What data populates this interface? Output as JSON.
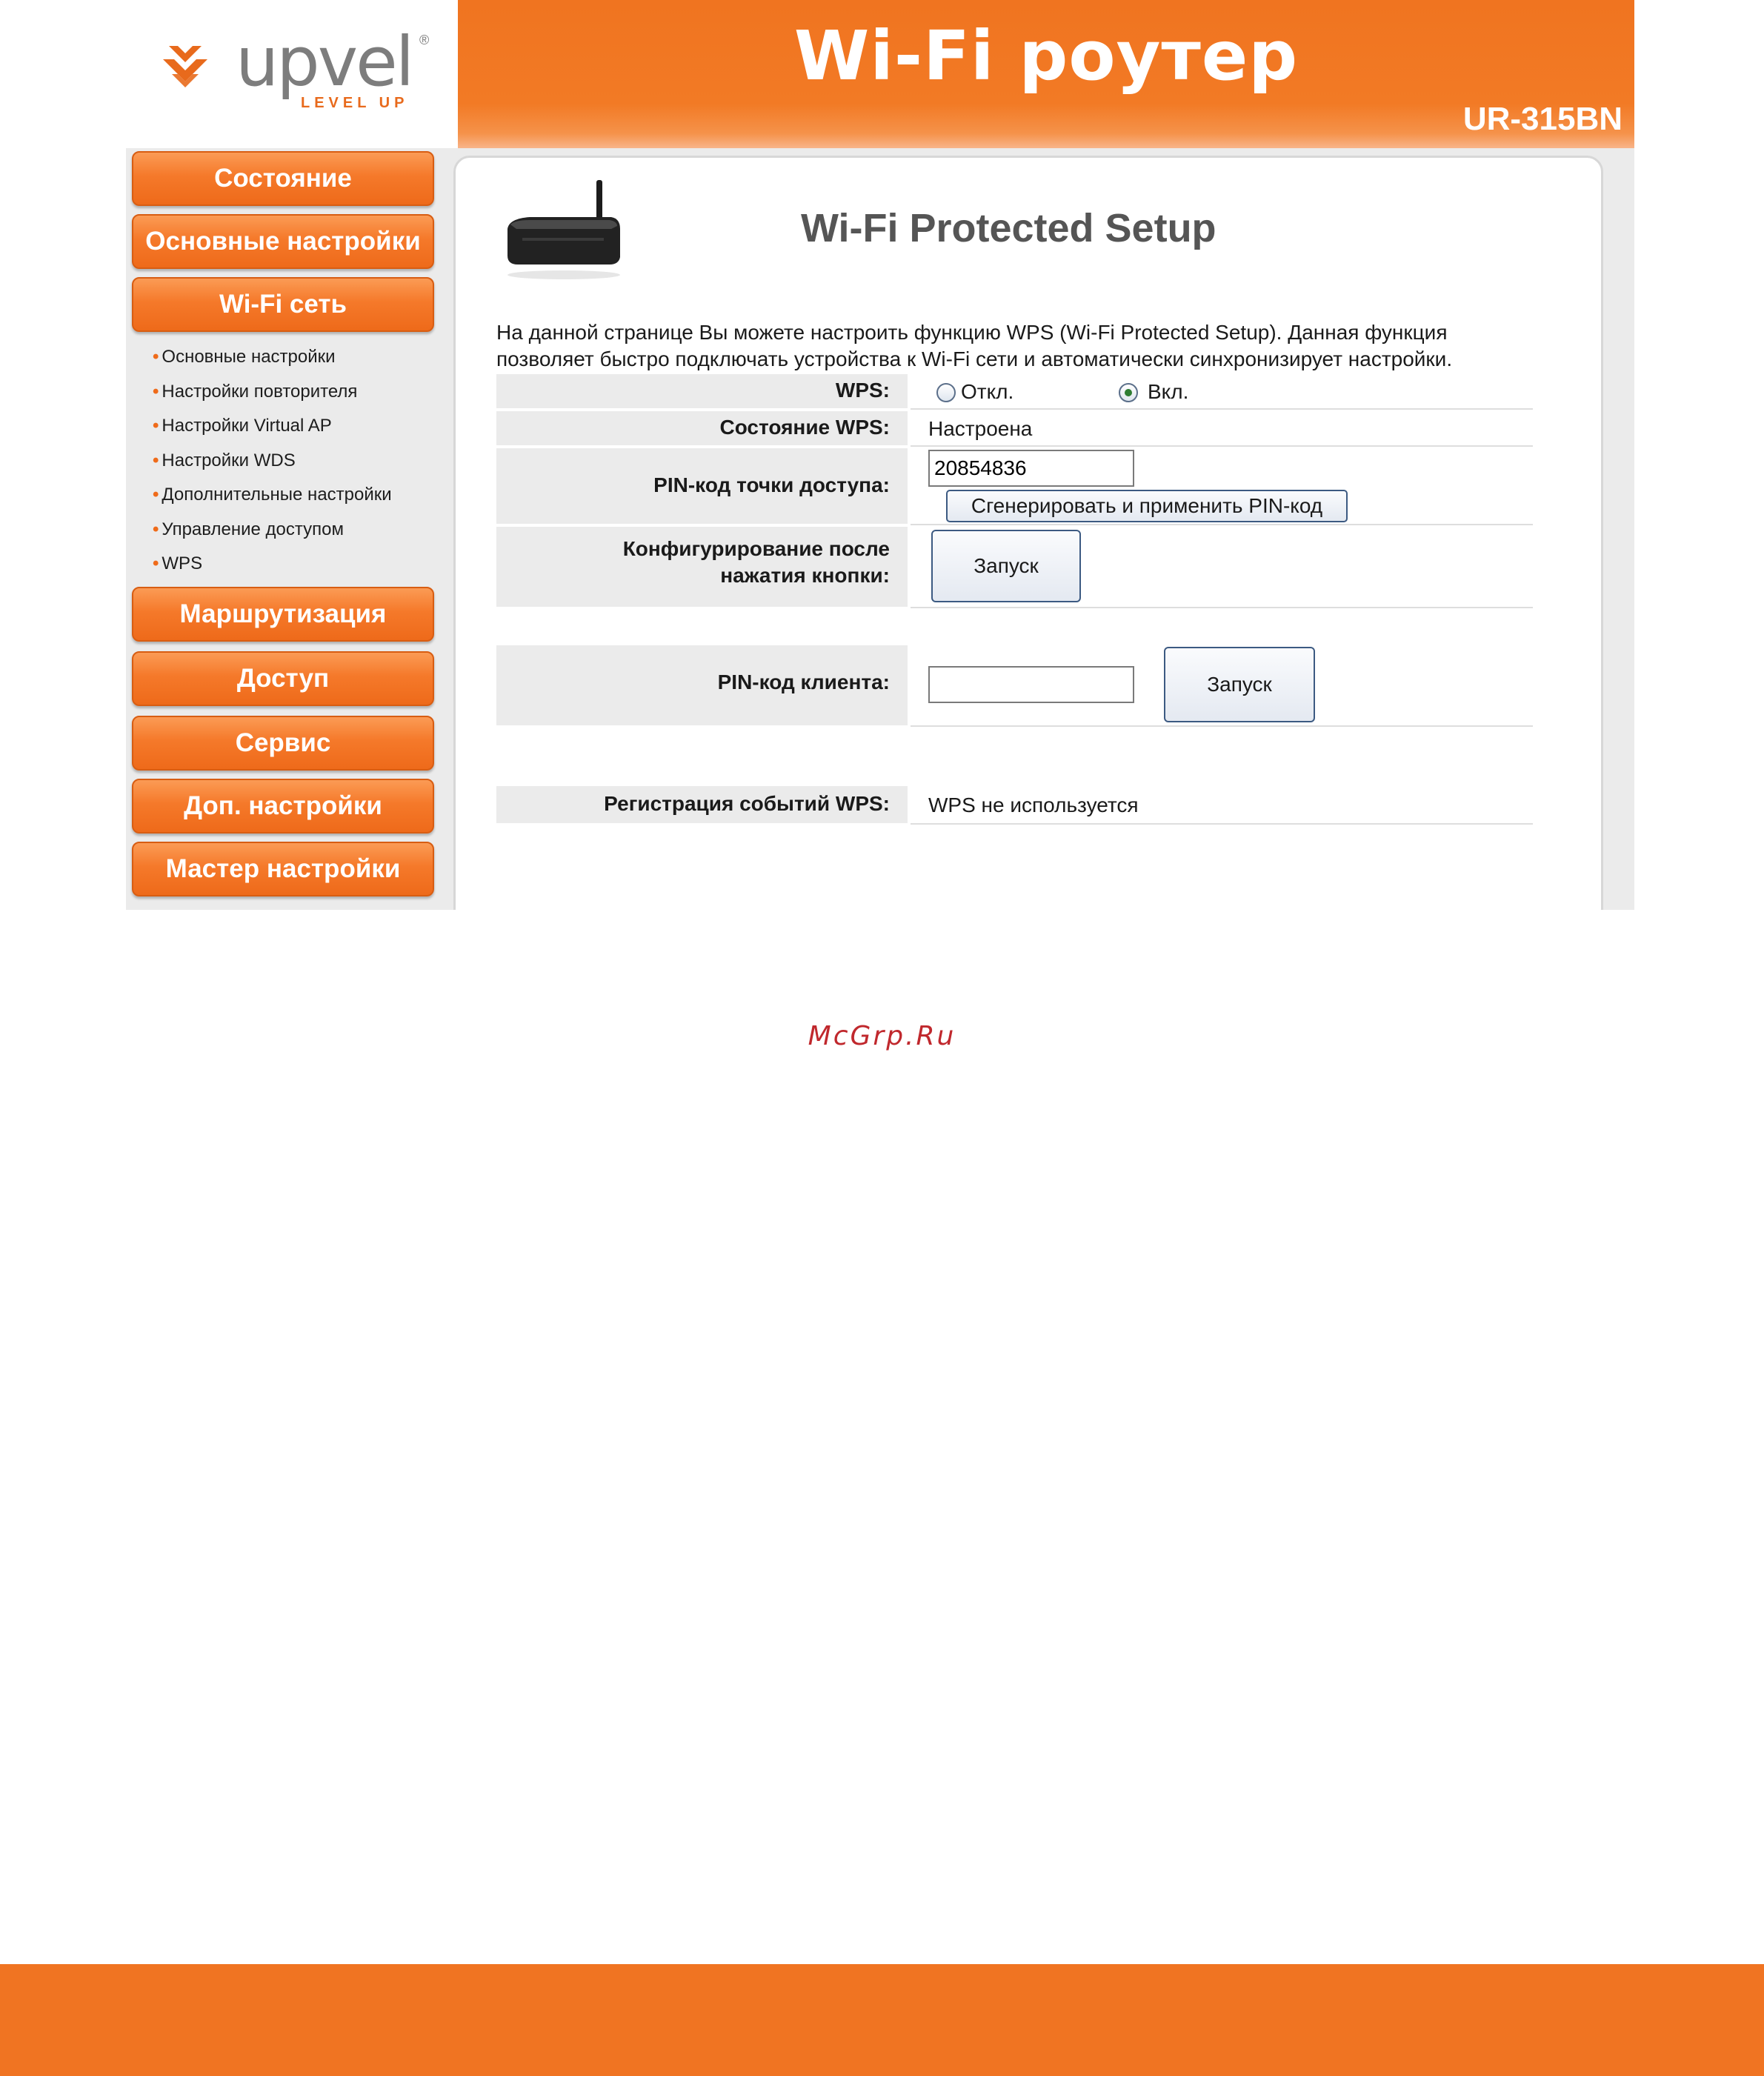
{
  "header": {
    "logo_word": "upvel",
    "logo_tag": "LEVEL UP",
    "logo_reg": "®",
    "title": "Wi-Fi роутер",
    "model": "UR-315BN"
  },
  "sidebar": {
    "menu": [
      "Состояние",
      "Основные настройки",
      "Wi-Fi сеть",
      "Маршрутизация",
      "Доступ",
      "Сервис",
      "Доп. настройки",
      "Мастер настройки"
    ],
    "wifi_submenu": [
      "Основные настройки",
      "Настройки повторителя",
      "Настройки Virtual AP",
      "Настройки WDS",
      "Дополнительные настройки",
      "Управление доступом",
      "WPS"
    ]
  },
  "main": {
    "title": "Wi-Fi Protected Setup",
    "description_line1": "На данной странице Вы можете настроить функцию WPS (Wi-Fi Protected Setup). Данная функция",
    "description_line2": "позволяет быстро подключать устройства к Wi-Fi сети и автоматически синхронизирует настройки.",
    "wps_label": "WPS:",
    "wps_off": "Откл.",
    "wps_on": "Вкл.",
    "wps_selected": "on",
    "status_label": "Состояние WPS:",
    "status_value": "Настроена",
    "ap_pin_label": "PIN-код точки доступа:",
    "ap_pin_value": "20854836",
    "generate_button": "Сгенерировать  и применить PIN-код",
    "pbc_label_line1": "Конфигурирование после",
    "pbc_label_line2": "нажатия кнопки:",
    "pbc_button": "Запуск",
    "client_pin_label": "PIN-код клиента:",
    "client_pin_value": "",
    "client_pin_button": "Запуск",
    "log_label": "Регистрация событий WPS:",
    "log_value": "WPS не используется"
  },
  "page": {
    "watermark": "McGrp.Ru"
  },
  "colors": {
    "accent": "#f07420",
    "panel_bg": "#ebebeb",
    "watermark": "#c0282d"
  }
}
